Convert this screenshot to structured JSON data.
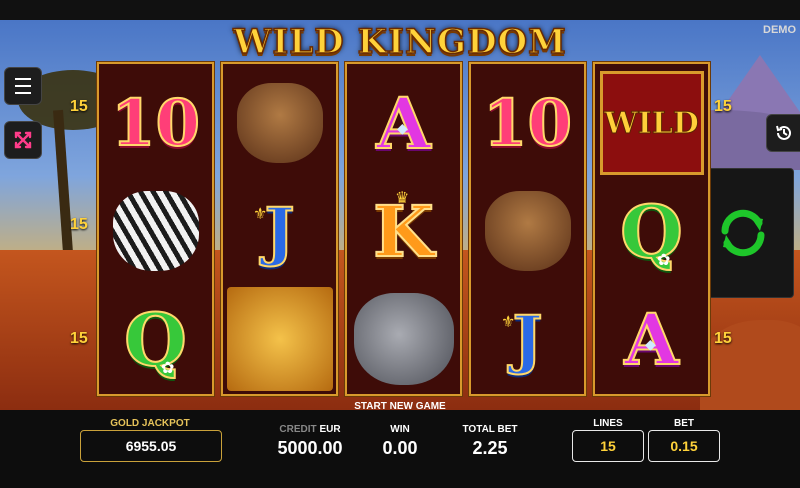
{
  "game": {
    "title": "WILD KINGDOM",
    "mode_badge": "DEMO"
  },
  "reels": [
    [
      {
        "kind": "text",
        "label": "10",
        "style": "ten"
      },
      {
        "kind": "animal",
        "name": "zebra"
      },
      {
        "kind": "text",
        "label": "Q",
        "style": "letterQ",
        "deco": "flower"
      }
    ],
    [
      {
        "kind": "animal",
        "name": "warthog"
      },
      {
        "kind": "text",
        "label": "J",
        "style": "letterJ",
        "deco": "fleur"
      },
      {
        "kind": "animal",
        "name": "lion"
      }
    ],
    [
      {
        "kind": "text",
        "label": "A",
        "style": "letterA",
        "deco": "diamond"
      },
      {
        "kind": "text",
        "label": "K",
        "style": "letterK",
        "deco": "crown"
      },
      {
        "kind": "animal",
        "name": "rhino"
      }
    ],
    [
      {
        "kind": "text",
        "label": "10",
        "style": "ten"
      },
      {
        "kind": "animal",
        "name": "warthog"
      },
      {
        "kind": "text",
        "label": "J",
        "style": "letterJ",
        "deco": "fleur"
      }
    ],
    [
      {
        "kind": "wild",
        "label": "WILD"
      },
      {
        "kind": "text",
        "label": "Q",
        "style": "letterQ",
        "deco": "flower"
      },
      {
        "kind": "text",
        "label": "A",
        "style": "letterA",
        "deco": "diamond"
      }
    ]
  ],
  "paylines": {
    "left": [
      "15",
      "15",
      "15"
    ],
    "right": [
      "15",
      "15"
    ]
  },
  "status_message": "START NEW GAME",
  "jackpot": {
    "label": "GOLD JACKPOT",
    "value": "6955.05"
  },
  "credit": {
    "label": "CREDIT",
    "currency": "EUR",
    "value": "5000.00"
  },
  "win": {
    "label": "WIN",
    "value": "0.00"
  },
  "total_bet": {
    "label": "TOTAL BET",
    "value": "2.25"
  },
  "lines": {
    "label": "LINES",
    "value": "15"
  },
  "bet": {
    "label": "BET",
    "value": "0.15"
  },
  "icons": {
    "menu": "hamburger-menu-icon",
    "fullscreen": "fullscreen-icon",
    "history": "history-icon",
    "spin": "spin-refresh-icon"
  },
  "colors": {
    "gold": "#ffd23a",
    "spin_green": "#1ec62a",
    "reel_bg": "#3e0c08",
    "frame": "#d89a2c"
  }
}
